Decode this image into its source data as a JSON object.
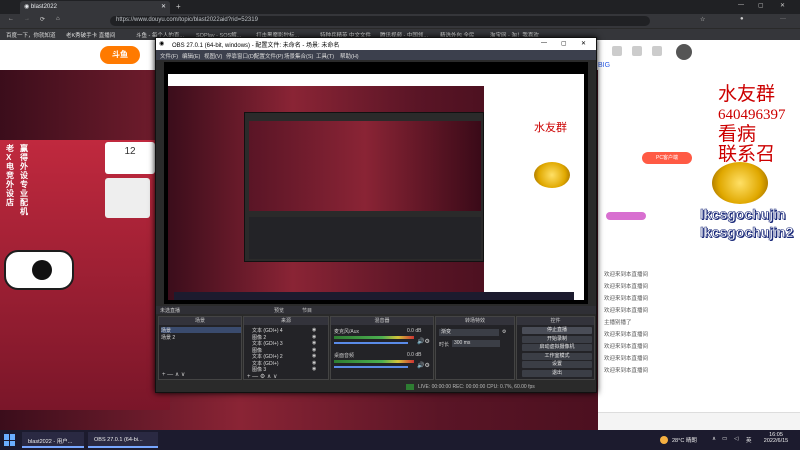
{
  "browser": {
    "tabs": [
      {
        "label": "blast2022"
      }
    ],
    "url": "https://www.douyu.com/topic/blast2022aid?rid=52319",
    "bookmarks": [
      "百度一下，你就知道",
      "老K秀破手卡 直播间",
      "斗鱼 - 每个人的直...",
      "SOPlay - SOS解...",
      "打击黑魔影狞标...",
      "特种兵精英 中文文件",
      "腾讯视频 - 中国领...",
      "精选外包 全民",
      "淘宝网 - 淘！我喜欢"
    ]
  },
  "site": {
    "header_badge": "BIG",
    "left_vertical_text": "老X电竞外设店",
    "left_vertical_text2": "赢得外设 专业配机",
    "tile_count": "12",
    "right_overlay": {
      "line1": "水友群",
      "line2": "640496397",
      "line3": "看病",
      "line4": "联系召",
      "name1": "lkcsgochujin",
      "name2": "lkcsgochujin2"
    },
    "chat": [
      "欢迎来到本直播间",
      "欢迎来到本直播间",
      "欢迎来到本直播间",
      "欢迎来到本直播间",
      "主播别播了",
      "欢迎来到本直播间",
      "欢迎来到本直播间",
      "欢迎来到本直播间",
      "欢迎来到本直播间"
    ]
  },
  "obs": {
    "title": "OBS 27.0.1 (64-bit, windows) - 配置文件: 未命名 - 场景: 未命名",
    "menu": [
      "文件(F)",
      "编辑(E)",
      "视图(V)",
      "停靠窗口(D)",
      "配置文件(P)",
      "场景集合(S)",
      "工具(T)",
      "帮助(H)"
    ],
    "labels": {
      "preview": "预览",
      "program": "节目"
    },
    "dock_headers": [
      "场景",
      "来源",
      "混音器",
      "转场特效",
      "控件"
    ],
    "scenes_label": "未选直播",
    "scenes": [
      "场景",
      "场景 2"
    ],
    "sources": [
      "文本 (GDI+) 4",
      "图像 2",
      "文本 (GDI+) 3",
      "图像",
      "文本 (GDI+) 2",
      "文本 (GDI+)",
      "图像 3"
    ],
    "mixer": [
      {
        "name": "麦克风/Aux",
        "level": "0.0 dB"
      },
      {
        "name": "桌面音频",
        "level": "0.0 dB"
      }
    ],
    "transition": {
      "type": "渐变",
      "duration_label": "时长",
      "duration": "300 ms"
    },
    "controls": [
      "停止直播",
      "开始录制",
      "启动虚拟摄像机",
      "工作室模式",
      "设置",
      "退出"
    ],
    "status": "LIVE: 00:00:00   REC: 00:00:00   CPU: 0.7%, 60.00 fps"
  },
  "taskbar": {
    "apps": [
      "blast2022 - 用户...",
      "OBS 27.0.1 (64-bi..."
    ],
    "weather": "28°C 晴朗",
    "ime": "英",
    "time": "16:05",
    "date": "2022/6/15"
  }
}
